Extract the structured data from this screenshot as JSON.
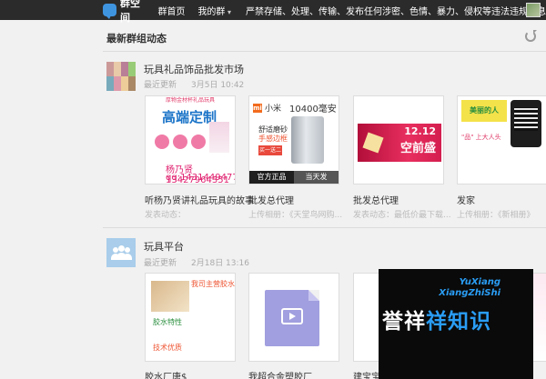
{
  "topbar": {
    "logo_text": "群空间",
    "nav": [
      "群首页",
      "我的群"
    ],
    "notice": "严禁存储、处理、传输、发布任何涉密、色情、暴力、侵权等违法违规信息"
  },
  "feed": {
    "heading": "最新群组动态"
  },
  "groups": [
    {
      "name": "玩具礼品饰品批发市场",
      "meta_label": "最近更新",
      "meta_time": "3月5日 10:42",
      "cards": [
        {
          "title": "听杨乃贤讲礼品玩具的故事",
          "sub": "发表动态：",
          "art": {
            "band": "厚物金材杯礼品玩具",
            "big": "高端定制",
            "phone": "杨乃贤13427964351",
            "qq": "qq:1431449477"
          }
        },
        {
          "title": "批发总代理",
          "sub": "上传相册：《天堂鸟网购...",
          "art": {
            "brand": "小米",
            "capacity": "10400毫安",
            "line1": "舒适磨砂",
            "line2": "手感边框",
            "badge": "买一送二",
            "foot_left": "官方正品",
            "foot_right": "当天发"
          }
        },
        {
          "title": "批发总代理",
          "sub": "发表动态：最低价最下载...",
          "art": {
            "line1": "12.12",
            "line2": "空前盛"
          }
        },
        {
          "title": "发家",
          "sub": "上传相册：《新相册》",
          "art": {
            "badge": "美丽的人",
            "text": "\"品\" 上大人头"
          }
        }
      ]
    },
    {
      "name": "玩具平台",
      "meta_label": "最近更新",
      "meta_time": "2月18日 13:16",
      "cards": [
        {
          "title": "胶水厂唐$",
          "sub": "",
          "art": {
            "hdr": "我司主营胶水",
            "t1": "胶水特性",
            "t3": "技术优质"
          }
        },
        {
          "title": "我超合金塑胶厂",
          "sub": ""
        },
        {
          "title": "建宝宝",
          "sub": ""
        },
        {
          "title": "发家",
          "sub": ""
        }
      ]
    }
  ],
  "watermark": {
    "en1": "YuXiang",
    "en2": "XiangZhiShi",
    "cn_white": "誉祥",
    "cn_blue": "祥知识"
  },
  "colors": {
    "topbar": "#2b2b2b",
    "accent": "#2a9df4",
    "background": "#f1f1f1"
  }
}
